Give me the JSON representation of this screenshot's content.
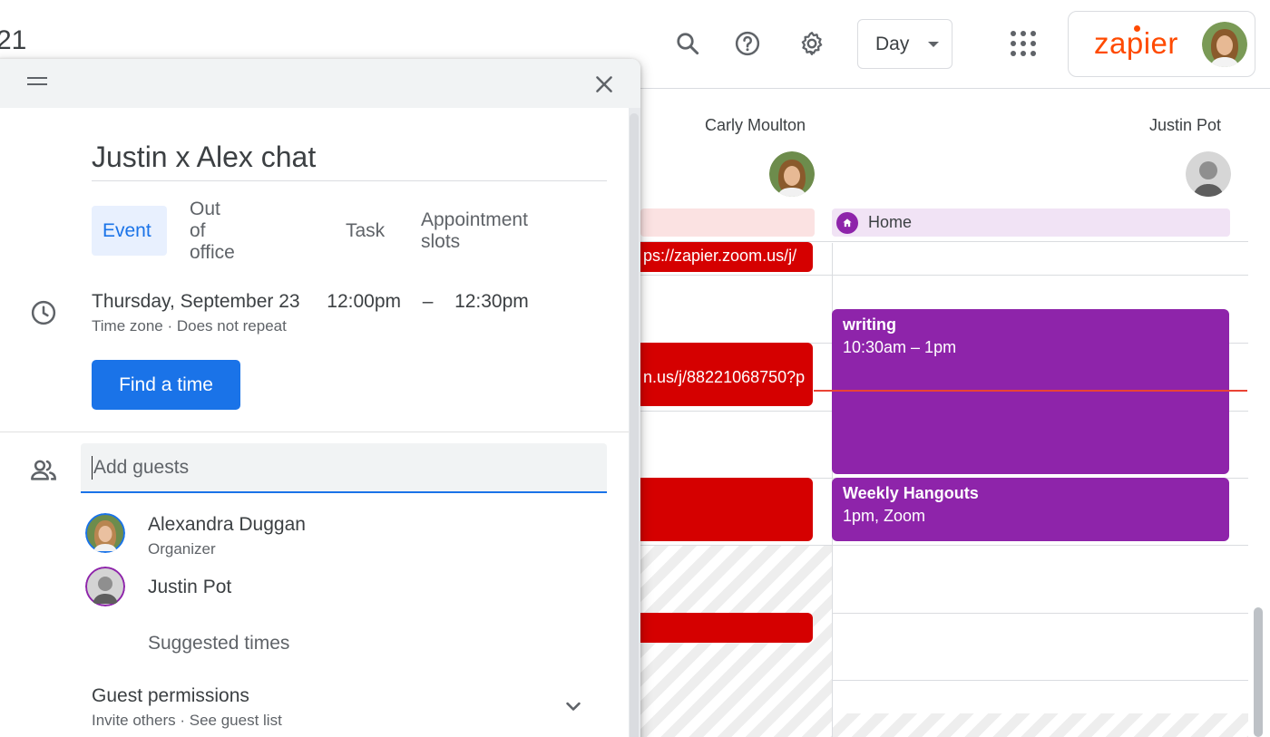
{
  "header": {
    "date_fragment": "21",
    "view_select": "Day",
    "account_brand": "zapier"
  },
  "columns": [
    {
      "name": "Carly Moulton"
    },
    {
      "name": "Justin Pot"
    }
  ],
  "events": {
    "home_label": "Home",
    "red_link_1": "ps://zapier.zoom.us/j/",
    "red_link_2": "n.us/j/88221068750?p",
    "writing_title": "writing",
    "writing_time": "10:30am – 1pm",
    "hangouts_title": "Weekly Hangouts",
    "hangouts_time": "1pm, Zoom"
  },
  "dialog": {
    "title": "Justin x Alex chat",
    "tabs": [
      {
        "label": "Event",
        "active": true
      },
      {
        "label": "Out of office",
        "active": false
      },
      {
        "label": "Task",
        "active": false
      },
      {
        "label": "Appointment slots",
        "active": false
      }
    ],
    "date": "Thursday, September 23",
    "start_time": "12:00pm",
    "dash": "–",
    "end_time": "12:30pm",
    "time_zone": "Time zone",
    "repeat": "Does not repeat",
    "separator": "·",
    "find_time": "Find a time",
    "guest_placeholder": "Add guests",
    "guests": [
      {
        "name": "Alexandra Duggan",
        "role": "Organizer"
      },
      {
        "name": "Justin Pot",
        "role": ""
      }
    ],
    "suggested_times": "Suggested times",
    "guest_permissions": {
      "title": "Guest permissions",
      "invite_others": "Invite others",
      "see_guest_list": "See guest list"
    }
  },
  "colors": {
    "accent_blue": "#1a73e8",
    "event_red": "#d50000",
    "event_purple": "#8e24aa",
    "brand_orange": "#ff4a00",
    "now_line": "#ea4335"
  },
  "icons": [
    "search-icon",
    "help-icon",
    "settings-icon",
    "apps-icon",
    "close-icon",
    "drag-handle-icon",
    "clock-icon",
    "people-icon",
    "home-icon",
    "chevron-down-icon"
  ]
}
